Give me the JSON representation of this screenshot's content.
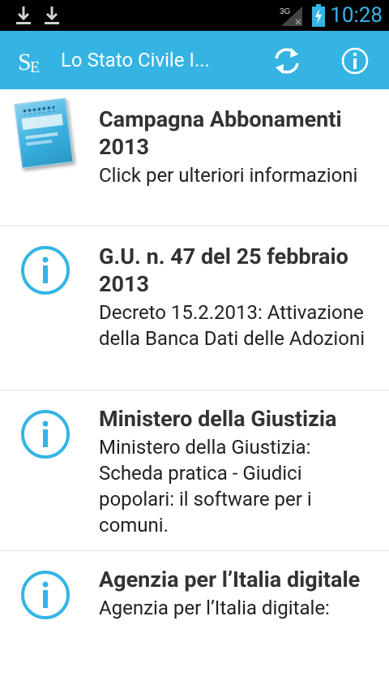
{
  "statusbar": {
    "time": "10:28",
    "network": "3G"
  },
  "actionbar": {
    "logo_text": "SE",
    "title": "Lo Stato Civile I...",
    "refresh_icon": "refresh-icon",
    "info_icon": "info-icon"
  },
  "list": {
    "items": [
      {
        "title": "Campagna Abbonamenti 2013",
        "desc": "Click per ulteriori informazioni",
        "icon": "magazine-thumbnail"
      },
      {
        "title": "G.U. n. 47 del 25 febbraio 2013",
        "desc": "Decreto 15.2.2013: Attivazione della Banca Dati delle Adozioni",
        "icon": "info-icon"
      },
      {
        "title": "Ministero della Giustizia",
        "desc": "Ministero della Giustizia: Scheda pratica - Giudici popolari: il software per i comuni.",
        "icon": "info-icon"
      },
      {
        "title": "Agenzia per l’Italia digitale",
        "desc": "Agenzia per l’Italia digitale:",
        "icon": "info-icon"
      }
    ]
  },
  "colors": {
    "accent": "#35b4e4",
    "status_accent": "#33b5e5",
    "info_ring": "#33b5e5"
  }
}
